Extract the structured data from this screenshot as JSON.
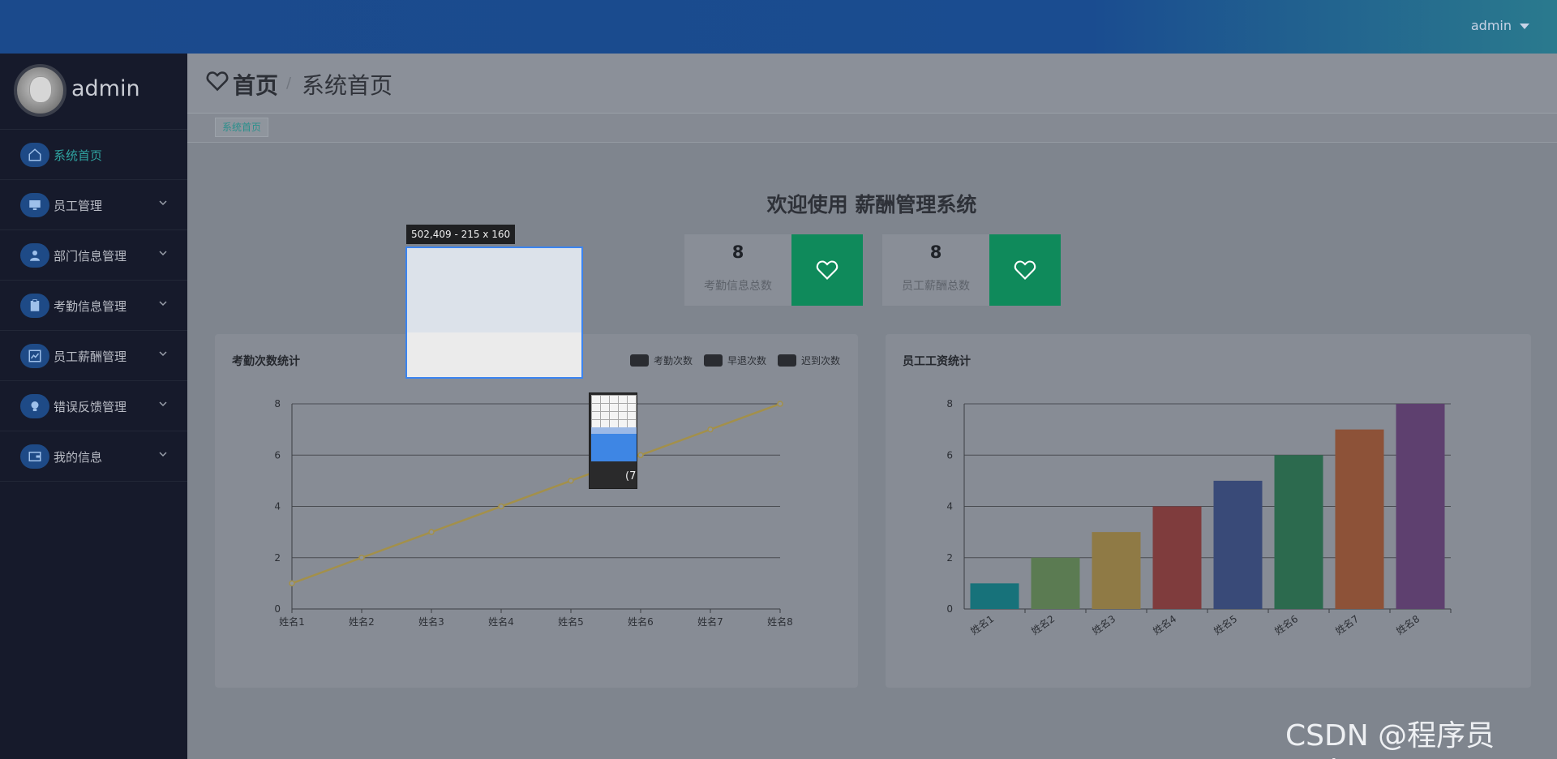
{
  "topbar": {
    "user": "admin"
  },
  "sidebar": {
    "profile_name": "admin",
    "items": [
      {
        "label": "系统首页",
        "icon": "home-icon",
        "active": true
      },
      {
        "label": "员工管理",
        "icon": "monitor-icon",
        "active": false
      },
      {
        "label": "部门信息管理",
        "icon": "user-icon",
        "active": false
      },
      {
        "label": "考勤信息管理",
        "icon": "clipboard-icon",
        "active": false
      },
      {
        "label": "员工薪酬管理",
        "icon": "chart-line-icon",
        "active": false
      },
      {
        "label": "错误反馈管理",
        "icon": "bulb-icon",
        "active": false
      },
      {
        "label": "我的信息",
        "icon": "wallet-icon",
        "active": false
      }
    ]
  },
  "header": {
    "title": "首页",
    "separator": "/",
    "subtitle": "系统首页"
  },
  "tabs": {
    "active": "系统首页"
  },
  "welcome": "欢迎使用 薪酬管理系统",
  "stats": [
    {
      "value": "8",
      "caption": "考勤信息总数"
    },
    {
      "value": "8",
      "caption": "员工薪酬总数"
    }
  ],
  "overlay": {
    "measure_label": "502,409 - 215 x 160",
    "magnifier_text": "(7"
  },
  "watermark": "CSDN @程序员code",
  "colors": {
    "accent_green": "#0f8a5b",
    "active_teal": "#2fa3a0",
    "topbar_blue": "#1b4a8c"
  },
  "chart_data": [
    {
      "type": "line",
      "title": "考勤次数统计",
      "legend": [
        "考勤次数",
        "早退次数",
        "迟到次数"
      ],
      "legend_position": "top-right",
      "categories": [
        "姓名1",
        "姓名2",
        "姓名3",
        "姓名4",
        "姓名5",
        "姓名6",
        "姓名7",
        "姓名8"
      ],
      "values": [
        1,
        2,
        3,
        4,
        5,
        6,
        7,
        8
      ],
      "ylim": [
        0,
        8
      ],
      "yticks": [
        0,
        2,
        4,
        6,
        8
      ],
      "grid": true,
      "color": "#a3904a"
    },
    {
      "type": "bar",
      "title": "员工工资统计",
      "categories": [
        "姓名1",
        "姓名2",
        "姓名3",
        "姓名4",
        "姓名5",
        "姓名6",
        "姓名7",
        "姓名8"
      ],
      "values": [
        1,
        2,
        3,
        4,
        5,
        6,
        7,
        8
      ],
      "colors": [
        "#17727a",
        "#5b7b52",
        "#8f7a45",
        "#7f3c3d",
        "#394a78",
        "#2c6a4e",
        "#8d5238",
        "#5e406f"
      ],
      "ylim": [
        0,
        8
      ],
      "yticks": [
        0,
        2,
        4,
        6,
        8
      ],
      "grid": true
    }
  ]
}
